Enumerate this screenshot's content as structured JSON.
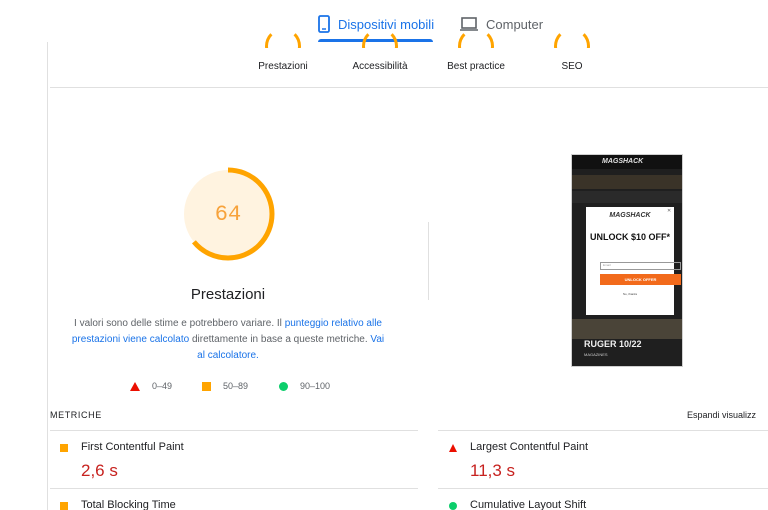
{
  "tabs": {
    "mobile": "Dispositivi mobili",
    "desktop": "Computer"
  },
  "categories": [
    {
      "label": "Prestazioni"
    },
    {
      "label": "Accessibilità"
    },
    {
      "label": "Best practice"
    },
    {
      "label": "SEO"
    }
  ],
  "performance": {
    "score": "64",
    "score_fraction": 0.64,
    "title": "Prestazioni",
    "desc_part1": "I valori sono delle stime e potrebbero variare. Il ",
    "desc_link1": "punteggio relativo alle prestazioni viene calcolato",
    "desc_part2": " direttamente in base a queste metriche. ",
    "desc_link2": "Vai al calcolatore.",
    "accent": "#ffa400"
  },
  "legend": {
    "poor": "0–49",
    "average": "50–89",
    "good": "90–100"
  },
  "screenshot": {
    "brand": "MAGSHACK",
    "modal_logo": "MAGSHACK",
    "modal_title": "UNLOCK $10 OFF*",
    "input_placeholder": "Email",
    "button": "UNLOCK OFFER",
    "decline": "No, thanks",
    "bottom_title": "RUGER 10/22",
    "bottom_sub": "MAGAZINES"
  },
  "metrics": {
    "heading": "METRICHE",
    "expand": "Espandi visualizz",
    "items": [
      {
        "label": "First Contentful Paint",
        "value": "2,6 s",
        "status": "average"
      },
      {
        "label": "Largest Contentful Paint",
        "value": "11,3 s",
        "status": "poor"
      },
      {
        "label": "Total Blocking Time",
        "status": "average"
      },
      {
        "label": "Cumulative Layout Shift",
        "status": "good"
      }
    ]
  }
}
